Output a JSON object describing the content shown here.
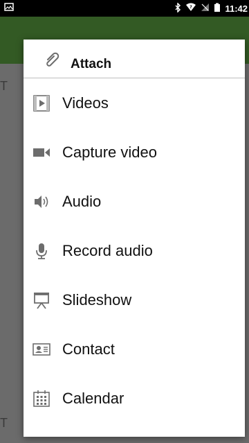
{
  "status_bar": {
    "time": "11:42",
    "icons": [
      "image-notification-icon",
      "bluetooth-icon",
      "wifi-icon",
      "signal-icon",
      "battery-icon"
    ]
  },
  "dialog": {
    "title": "Attach",
    "title_icon": "paperclip-icon",
    "items": [
      {
        "label": "Videos",
        "icon": "video-file-icon"
      },
      {
        "label": "Capture video",
        "icon": "video-camera-icon"
      },
      {
        "label": "Audio",
        "icon": "speaker-icon"
      },
      {
        "label": "Record audio",
        "icon": "microphone-icon"
      },
      {
        "label": "Slideshow",
        "icon": "slideshow-icon"
      },
      {
        "label": "Contact",
        "icon": "contact-card-icon"
      },
      {
        "label": "Calendar",
        "icon": "calendar-icon"
      }
    ]
  },
  "colors": {
    "app_bar": "#335a24",
    "icon_gray": "#6d6d6d",
    "status_bar": "#000000"
  }
}
